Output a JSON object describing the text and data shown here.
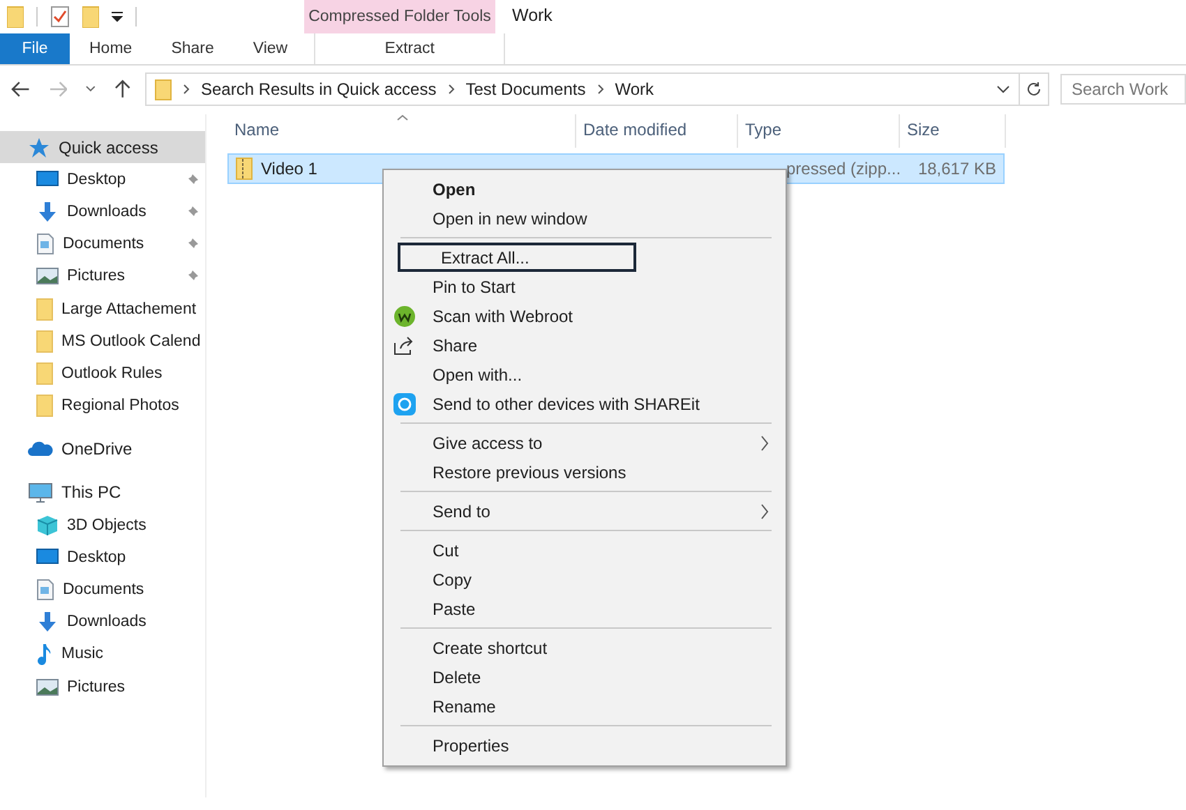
{
  "window": {
    "title": "Work"
  },
  "context_tab_group": {
    "label": "Compressed Folder Tools"
  },
  "ribbon_tabs": [
    {
      "label": "File",
      "kind": "file",
      "selected": false
    },
    {
      "label": "Home",
      "kind": "tab",
      "selected": false
    },
    {
      "label": "Share",
      "kind": "tab",
      "selected": false
    },
    {
      "label": "View",
      "kind": "tab",
      "selected": false
    },
    {
      "label": "Extract",
      "kind": "context",
      "selected": false
    }
  ],
  "address": {
    "crumbs": [
      "Search Results in Quick access",
      "Test Documents",
      "Work"
    ]
  },
  "search": {
    "placeholder": "Search Work"
  },
  "sidebar": {
    "items": [
      {
        "label": "Quick access",
        "kind": "star",
        "selected": true,
        "children": [
          {
            "label": "Desktop",
            "kind": "desktop",
            "pinned": true
          },
          {
            "label": "Downloads",
            "kind": "downloads",
            "pinned": true
          },
          {
            "label": "Documents",
            "kind": "documents",
            "pinned": true
          },
          {
            "label": "Pictures",
            "kind": "pictures",
            "pinned": true
          },
          {
            "label": "Large Attachement",
            "kind": "folder",
            "pinned": false
          },
          {
            "label": "MS Outlook Calend",
            "kind": "folder",
            "pinned": false
          },
          {
            "label": "Outlook Rules",
            "kind": "folder",
            "pinned": false
          },
          {
            "label": "Regional Photos",
            "kind": "folder",
            "pinned": false
          }
        ]
      },
      {
        "label": "OneDrive",
        "kind": "cloud",
        "selected": false
      },
      {
        "label": "This PC",
        "kind": "pc",
        "selected": false,
        "children": [
          {
            "label": "3D Objects",
            "kind": "cube",
            "pinned": false
          },
          {
            "label": "Desktop",
            "kind": "desktop",
            "pinned": false
          },
          {
            "label": "Documents",
            "kind": "documents",
            "pinned": false
          },
          {
            "label": "Downloads",
            "kind": "downloads",
            "pinned": false
          },
          {
            "label": "Music",
            "kind": "music",
            "pinned": false
          },
          {
            "label": "Pictures",
            "kind": "pictures",
            "pinned": false
          }
        ]
      }
    ]
  },
  "table": {
    "columns": [
      "Name",
      "Date modified",
      "Type",
      "Size"
    ],
    "rows": [
      {
        "name": "Video 1",
        "type": "pressed (zipp...",
        "size": "18,617 KB",
        "selected": true
      }
    ]
  },
  "context_menu": {
    "items": [
      {
        "label": "Open",
        "kind": "default"
      },
      {
        "label": "Open in new window",
        "kind": "item"
      },
      {
        "kind": "separator"
      },
      {
        "label": "Extract All...",
        "kind": "item",
        "focused": true
      },
      {
        "label": "Pin to Start",
        "kind": "item"
      },
      {
        "label": "Scan with Webroot",
        "kind": "webroot"
      },
      {
        "label": "Share",
        "kind": "share"
      },
      {
        "label": "Open with...",
        "kind": "item"
      },
      {
        "label": "Send to other devices with SHAREit",
        "kind": "shareit"
      },
      {
        "kind": "separator"
      },
      {
        "label": "Give access to",
        "kind": "submenu"
      },
      {
        "label": "Restore previous versions",
        "kind": "item"
      },
      {
        "kind": "separator"
      },
      {
        "label": "Send to",
        "kind": "submenu"
      },
      {
        "kind": "separator"
      },
      {
        "label": "Cut",
        "kind": "item"
      },
      {
        "label": "Copy",
        "kind": "item"
      },
      {
        "label": "Paste",
        "kind": "item"
      },
      {
        "kind": "separator"
      },
      {
        "label": "Create shortcut",
        "kind": "item"
      },
      {
        "label": "Delete",
        "kind": "item"
      },
      {
        "label": "Rename",
        "kind": "item"
      },
      {
        "kind": "separator"
      },
      {
        "label": "Properties",
        "kind": "item"
      }
    ]
  }
}
